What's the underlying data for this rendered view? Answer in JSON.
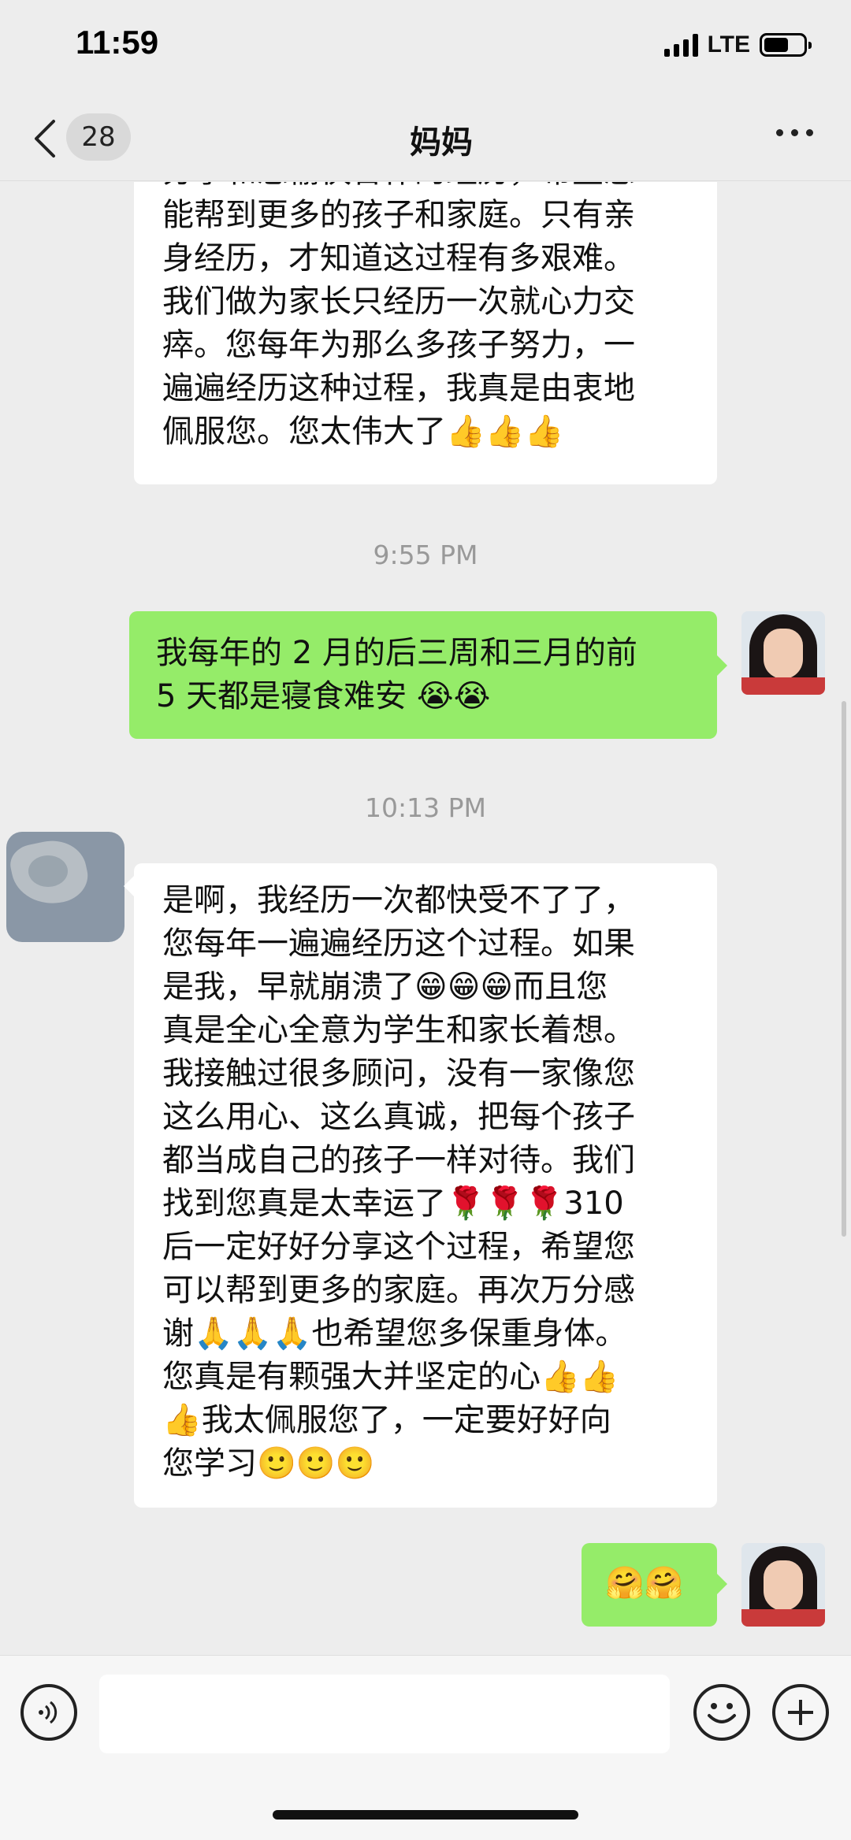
{
  "status_bar": {
    "time": "11:59",
    "network": "LTE"
  },
  "header": {
    "unread_count": "28",
    "title": "妈妈"
  },
  "messages": [
    {
      "side": "left",
      "text": "分享和您愉快合作的经历，希望您\n能帮到更多的孩子和家庭。只有亲\n身经历，才知道这过程有多艰难。\n我们做为家长只经历一次就心力交\n瘁。您每年为那么多孩子努力，一\n遍遍经历这种过程，我真是由衷地\n佩服您。您太伟大了👍👍👍"
    },
    {
      "time": "9:55 PM"
    },
    {
      "side": "right",
      "text": "我每年的 2 月的后三周和三月的前\n5 天都是寝食难安 😭😭"
    },
    {
      "time": "10:13 PM"
    },
    {
      "side": "left",
      "text": "是啊，我经历一次都快受不了了，\n您每年一遍遍经历这个过程。如果\n是我，早就崩溃了😁😁😁而且您\n真是全心全意为学生和家长着想。\n我接触过很多顾问，没有一家像您\n这么用心、这么真诚，把每个孩子\n都当成自己的孩子一样对待。我们\n找到您真是太幸运了🌹🌹🌹310\n后一定好好分享这个过程，希望您\n可以帮到更多的家庭。再次万分感\n谢🙏🙏🙏也希望您多保重身体。\n您真是有颗强大并坚定的心👍👍\n👍我太佩服您了，一定要好好向\n您学习🙂🙂🙂"
    },
    {
      "side": "right",
      "text": "🤗🤗"
    }
  ],
  "colors": {
    "self_bubble": "#95ec69",
    "other_bubble": "#ffffff",
    "background": "#ededed"
  },
  "icons": [
    "back-icon",
    "more-icon",
    "voice-icon",
    "emoji-icon",
    "plus-icon"
  ]
}
